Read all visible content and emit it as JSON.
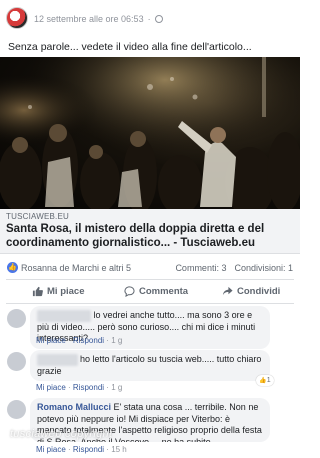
{
  "post": {
    "timestamp": "12 settembre alle ore 06:53",
    "text": "Senza parole... vedete il video alla fine dell'articolo..."
  },
  "link": {
    "domain": "TUSCIAWEB.EU",
    "title": "Santa Rosa, il mistero della doppia diretta e del coordinamento giornalistico... - Tusciaweb.eu"
  },
  "reactions": {
    "names": "Rosanna de Marchi e altri 5",
    "comments": "Commenti: 3",
    "shares": "Condivisioni: 1"
  },
  "actions": {
    "like": "Mi piace",
    "comment": "Commenta",
    "share": "Condividi"
  },
  "comments": [
    {
      "name": "",
      "text": "lo vedrei anche tutto.... ma sono 3 ore e più di video..... però sono curioso.... chi mi dice i minuti interessanti?",
      "like": "Mi piace",
      "reply": "Rispondi",
      "time": "1 g"
    },
    {
      "name": "",
      "text": "ho letto l'articolo su tuscia web..... tutto chiaro grazie",
      "like": "Mi piace",
      "reply": "Rispondi",
      "time": "1 g",
      "likes": "1"
    },
    {
      "name": "Romano Mallucci",
      "text": "E' stata una cosa ... terribile. Non ne potevo più neppure io! Mi dispiace per Viterbo: è mancato totalmente l'aspetto religioso proprio della festa di S.Rosa. Anche il Vescovo ... ne ha subito",
      "like": "Mi piace",
      "reply": "Rispondi",
      "time": "15 h"
    }
  ],
  "watermark": "tusciaweb copyright",
  "colors": {
    "link": "#385898",
    "accent": "#4a76e8",
    "meta": "#90949c"
  }
}
